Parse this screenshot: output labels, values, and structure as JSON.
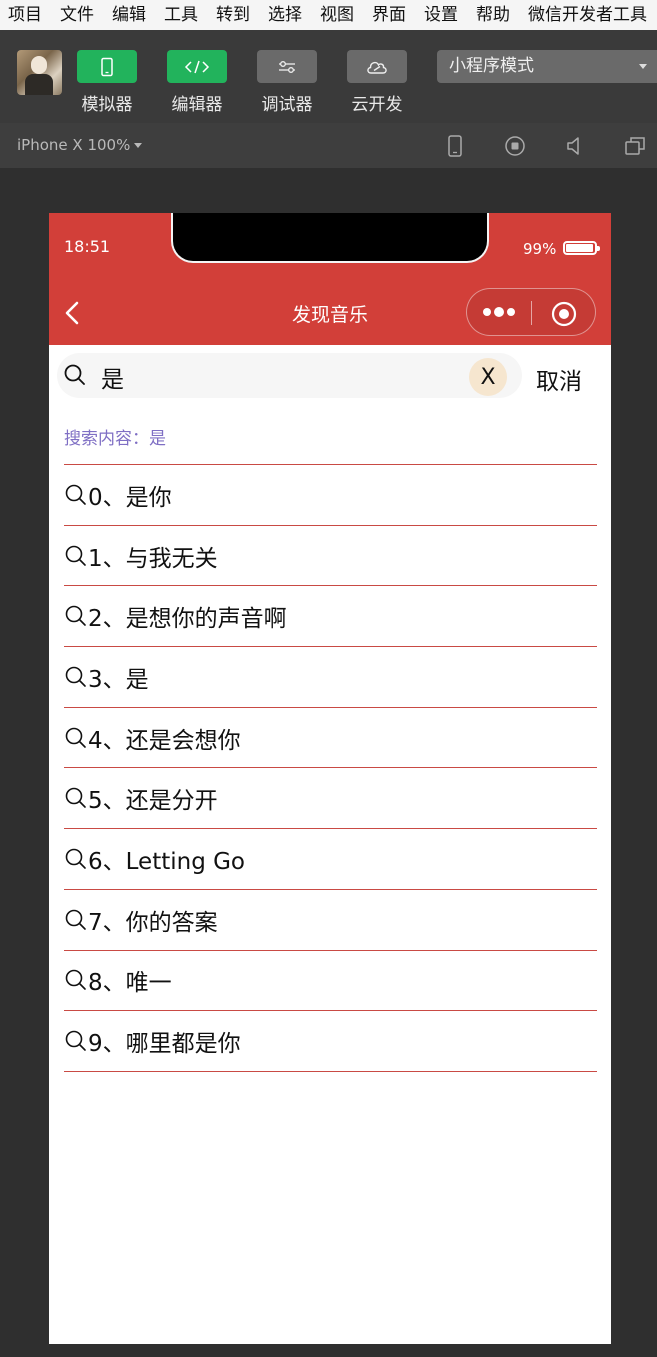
{
  "menubar": [
    "项目",
    "文件",
    "编辑",
    "工具",
    "转到",
    "选择",
    "视图",
    "界面",
    "设置",
    "帮助",
    "微信开发者工具"
  ],
  "toolbar": {
    "simulator": "模拟器",
    "editor": "编辑器",
    "debugger": "调试器",
    "cloud": "云开发",
    "mode": "小程序模式"
  },
  "device": {
    "label": "iPhone X 100%"
  },
  "colors": {
    "brand_red": "#d23f39",
    "green": "#22b35c",
    "purple": "#7f6fc4",
    "divider": "#c94a44"
  },
  "status": {
    "time": "18:51",
    "battery": "99%"
  },
  "nav": {
    "title": "发现音乐"
  },
  "search": {
    "value": "是",
    "clear": "X",
    "cancel": "取消",
    "info": "搜索内容：是"
  },
  "results": [
    "0、是你",
    "1、与我无关",
    "2、是想你的声音啊",
    "3、是",
    "4、还是会想你",
    "5、还是分开",
    "6、Letting Go",
    "7、你的答案",
    "8、唯一",
    "9、哪里都是你"
  ]
}
